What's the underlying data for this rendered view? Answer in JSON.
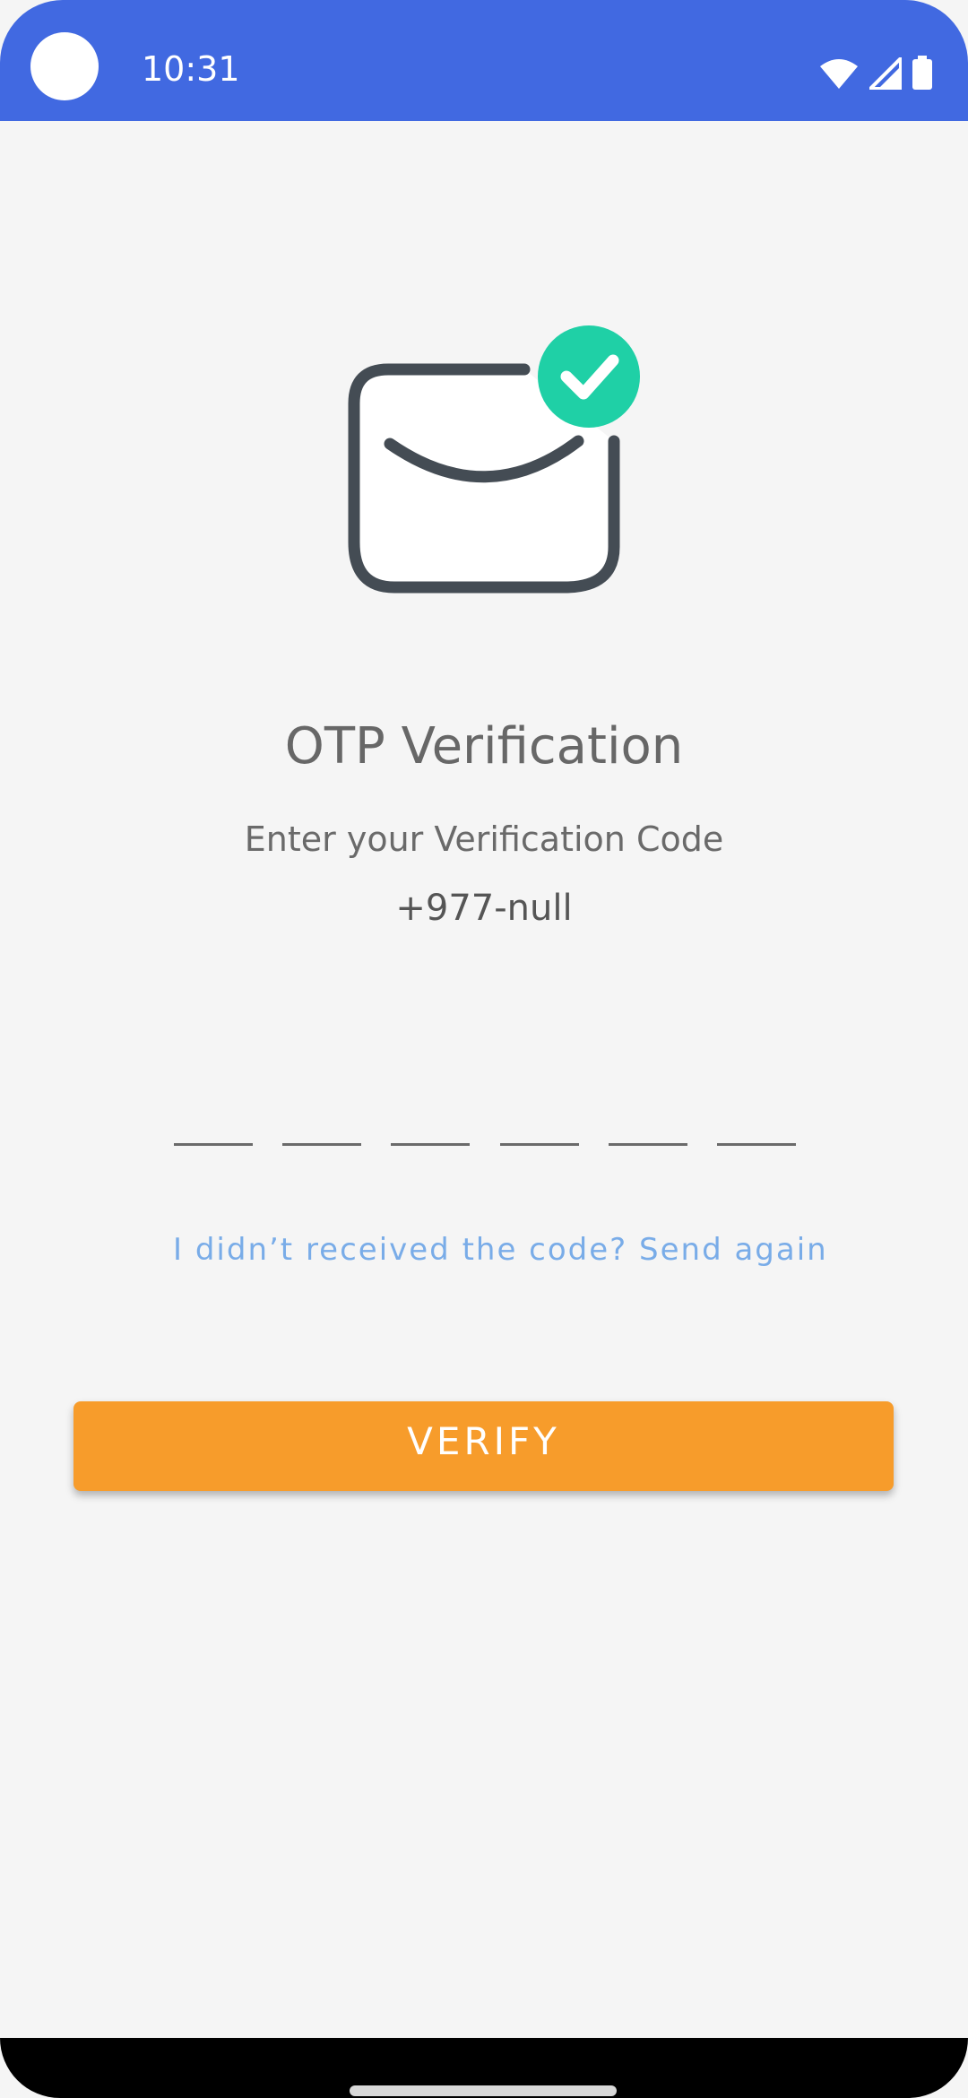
{
  "status_bar": {
    "time": "10:31",
    "icons": [
      "wifi-icon",
      "signal-icon",
      "battery-icon"
    ],
    "color": "#4169e1"
  },
  "illustration": {
    "icon": "envelope-check-icon",
    "check_color": "#1fd0a6",
    "outline_color": "#444c54"
  },
  "content": {
    "title": "OTP Verification",
    "subtitle": "Enter your Verification Code",
    "phone": "+977-null"
  },
  "otp": {
    "slots": [
      "",
      "",
      "",
      "",
      "",
      ""
    ]
  },
  "resend": {
    "text": "I didn’t received the code? Send again",
    "color": "#79ace8"
  },
  "verify": {
    "label": "VERIFY",
    "color": "#f79c2b"
  }
}
